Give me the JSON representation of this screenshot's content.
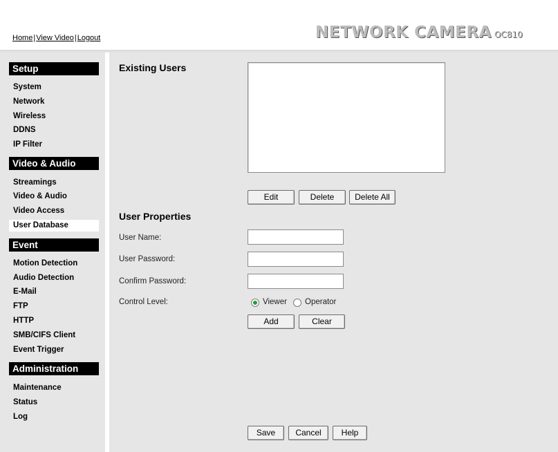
{
  "header": {
    "links": [
      "Home",
      "View Video",
      "Logout"
    ],
    "separator": "|",
    "brand": "NETWORK CAMERA",
    "model": "OC810"
  },
  "sidebar": {
    "sections": [
      {
        "title": "Setup",
        "items": [
          "System",
          "Network",
          "Wireless",
          "DDNS",
          "IP Filter"
        ]
      },
      {
        "title": "Video & Audio",
        "items": [
          "Streamings",
          "Video & Audio",
          "Video Access",
          "User Database"
        ]
      },
      {
        "title": "Event",
        "items": [
          "Motion Detection",
          "Audio Detection",
          "E-Mail",
          "FTP",
          "HTTP",
          "SMB/CIFS Client",
          "Event Trigger"
        ]
      },
      {
        "title": "Administration",
        "items": [
          "Maintenance",
          "Status",
          "Log"
        ]
      }
    ],
    "active_item": "User Database"
  },
  "existing_users": {
    "title": "Existing Users",
    "users": [],
    "buttons": {
      "edit": "Edit",
      "delete": "Delete",
      "delete_all": "Delete All"
    }
  },
  "user_properties": {
    "title": "User Properties",
    "user_name": {
      "label": "User Name:",
      "value": ""
    },
    "user_password": {
      "label": "User Password:",
      "value": ""
    },
    "confirm_password": {
      "label": "Confirm Password:",
      "value": ""
    },
    "control_level": {
      "label": "Control Level:",
      "options": [
        "Viewer",
        "Operator"
      ],
      "selected": "Viewer"
    },
    "buttons": {
      "add": "Add",
      "clear": "Clear"
    }
  },
  "footer_buttons": {
    "save": "Save",
    "cancel": "Cancel",
    "help": "Help"
  },
  "colors": {
    "panel": "#e6e6e6",
    "section_header": "#000000",
    "radio_selected": "#2a9a3a"
  }
}
